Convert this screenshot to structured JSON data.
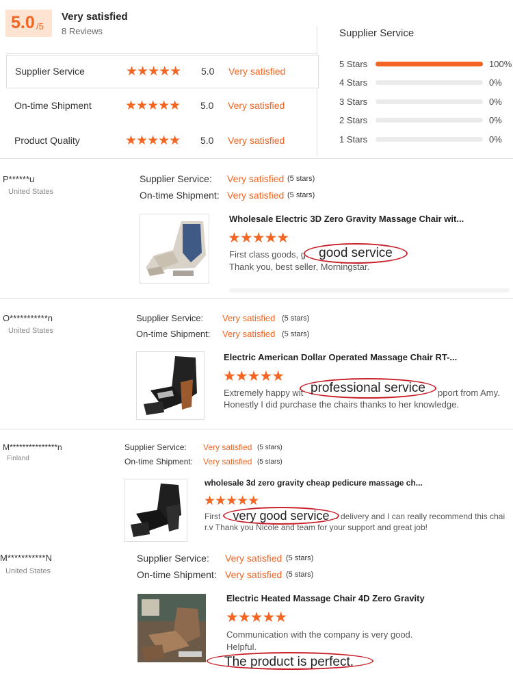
{
  "summary": {
    "score": "5.0",
    "score_max": "/5",
    "title": "Very satisfied",
    "reviews": "8 Reviews"
  },
  "ratings": [
    {
      "label": "Supplier Service",
      "score": "5.0",
      "text": "Very satisfied",
      "stars": 5
    },
    {
      "label": "On-time Shipment",
      "score": "5.0",
      "text": "Very satisfied",
      "stars": 5
    },
    {
      "label": "Product Quality",
      "score": "5.0",
      "text": "Very satisfied",
      "stars": 5
    }
  ],
  "distribution": {
    "title": "Supplier Service",
    "rows": [
      {
        "label": "5 Stars",
        "fraction": 1.0,
        "pct": "100%"
      },
      {
        "label": "4 Stars",
        "fraction": 0,
        "pct": "0%"
      },
      {
        "label": "3 Stars",
        "fraction": 0,
        "pct": "0%"
      },
      {
        "label": "2 Stars",
        "fraction": 0,
        "pct": "0%"
      },
      {
        "label": "1 Stars",
        "fraction": 0,
        "pct": "0%"
      }
    ]
  },
  "review_labels": {
    "supplier": "Supplier Service:",
    "shipment": "On-time Shipment:"
  },
  "reviews": [
    {
      "user": "P******u",
      "country": "United States",
      "supplier_val": "Very satisfied",
      "supplier_stars": "(5 stars)",
      "shipment_val": "Very satisfied",
      "shipment_stars": "(5 stars)",
      "product": "Wholesale Electric 3D Zero Gravity Massage Chair wit...",
      "stars": 5,
      "text1": "First class goods, g",
      "text2": "Thank you, best seller, Morningstar.",
      "highlight": "good service"
    },
    {
      "user": "O***********n",
      "country": "United States",
      "supplier_val": "Very satisfied",
      "supplier_stars": "(5 stars)",
      "shipment_val": "Very satisfied",
      "shipment_stars": "(5 stars)",
      "product": "Electric American Dollar Operated Massage Chair RT-...",
      "stars": 5,
      "text1": "Extremely happy wit",
      "text1b": "pport from Amy.",
      "text2": "Honestly I did purchase the chairs thanks to her knowledge.",
      "highlight": "professional service"
    },
    {
      "user": "M***************n",
      "country": "Finland",
      "supplier_val": "Very satisfied",
      "supplier_stars": "(5 stars)",
      "shipment_val": "Very satisfied",
      "shipment_stars": "(5 stars)",
      "product": "wholesale 3d zero gravity cheap pedicure massage ch...",
      "stars": 5,
      "text1": "First",
      "text1b": "e delivery and I can really recommend this chai",
      "text2": "r.v Thank you Nicole and team for your support and great job!",
      "highlight": "very good service"
    },
    {
      "user": "M***********N",
      "country": "United States",
      "supplier_val": "Very satisfied",
      "supplier_stars": "(5 stars)",
      "shipment_val": "Very satisfied",
      "shipment_stars": "(5 stars)",
      "product": "Electric Heated Massage Chair 4D Zero Gravity",
      "stars": 5,
      "text1": "Communication with the company is very good.",
      "text2": "Helpful.",
      "highlight": "The product is perfect."
    }
  ],
  "colors": {
    "accent": "#f26522",
    "oval": "#c8202a"
  },
  "icons": {
    "star": "star-icon"
  }
}
